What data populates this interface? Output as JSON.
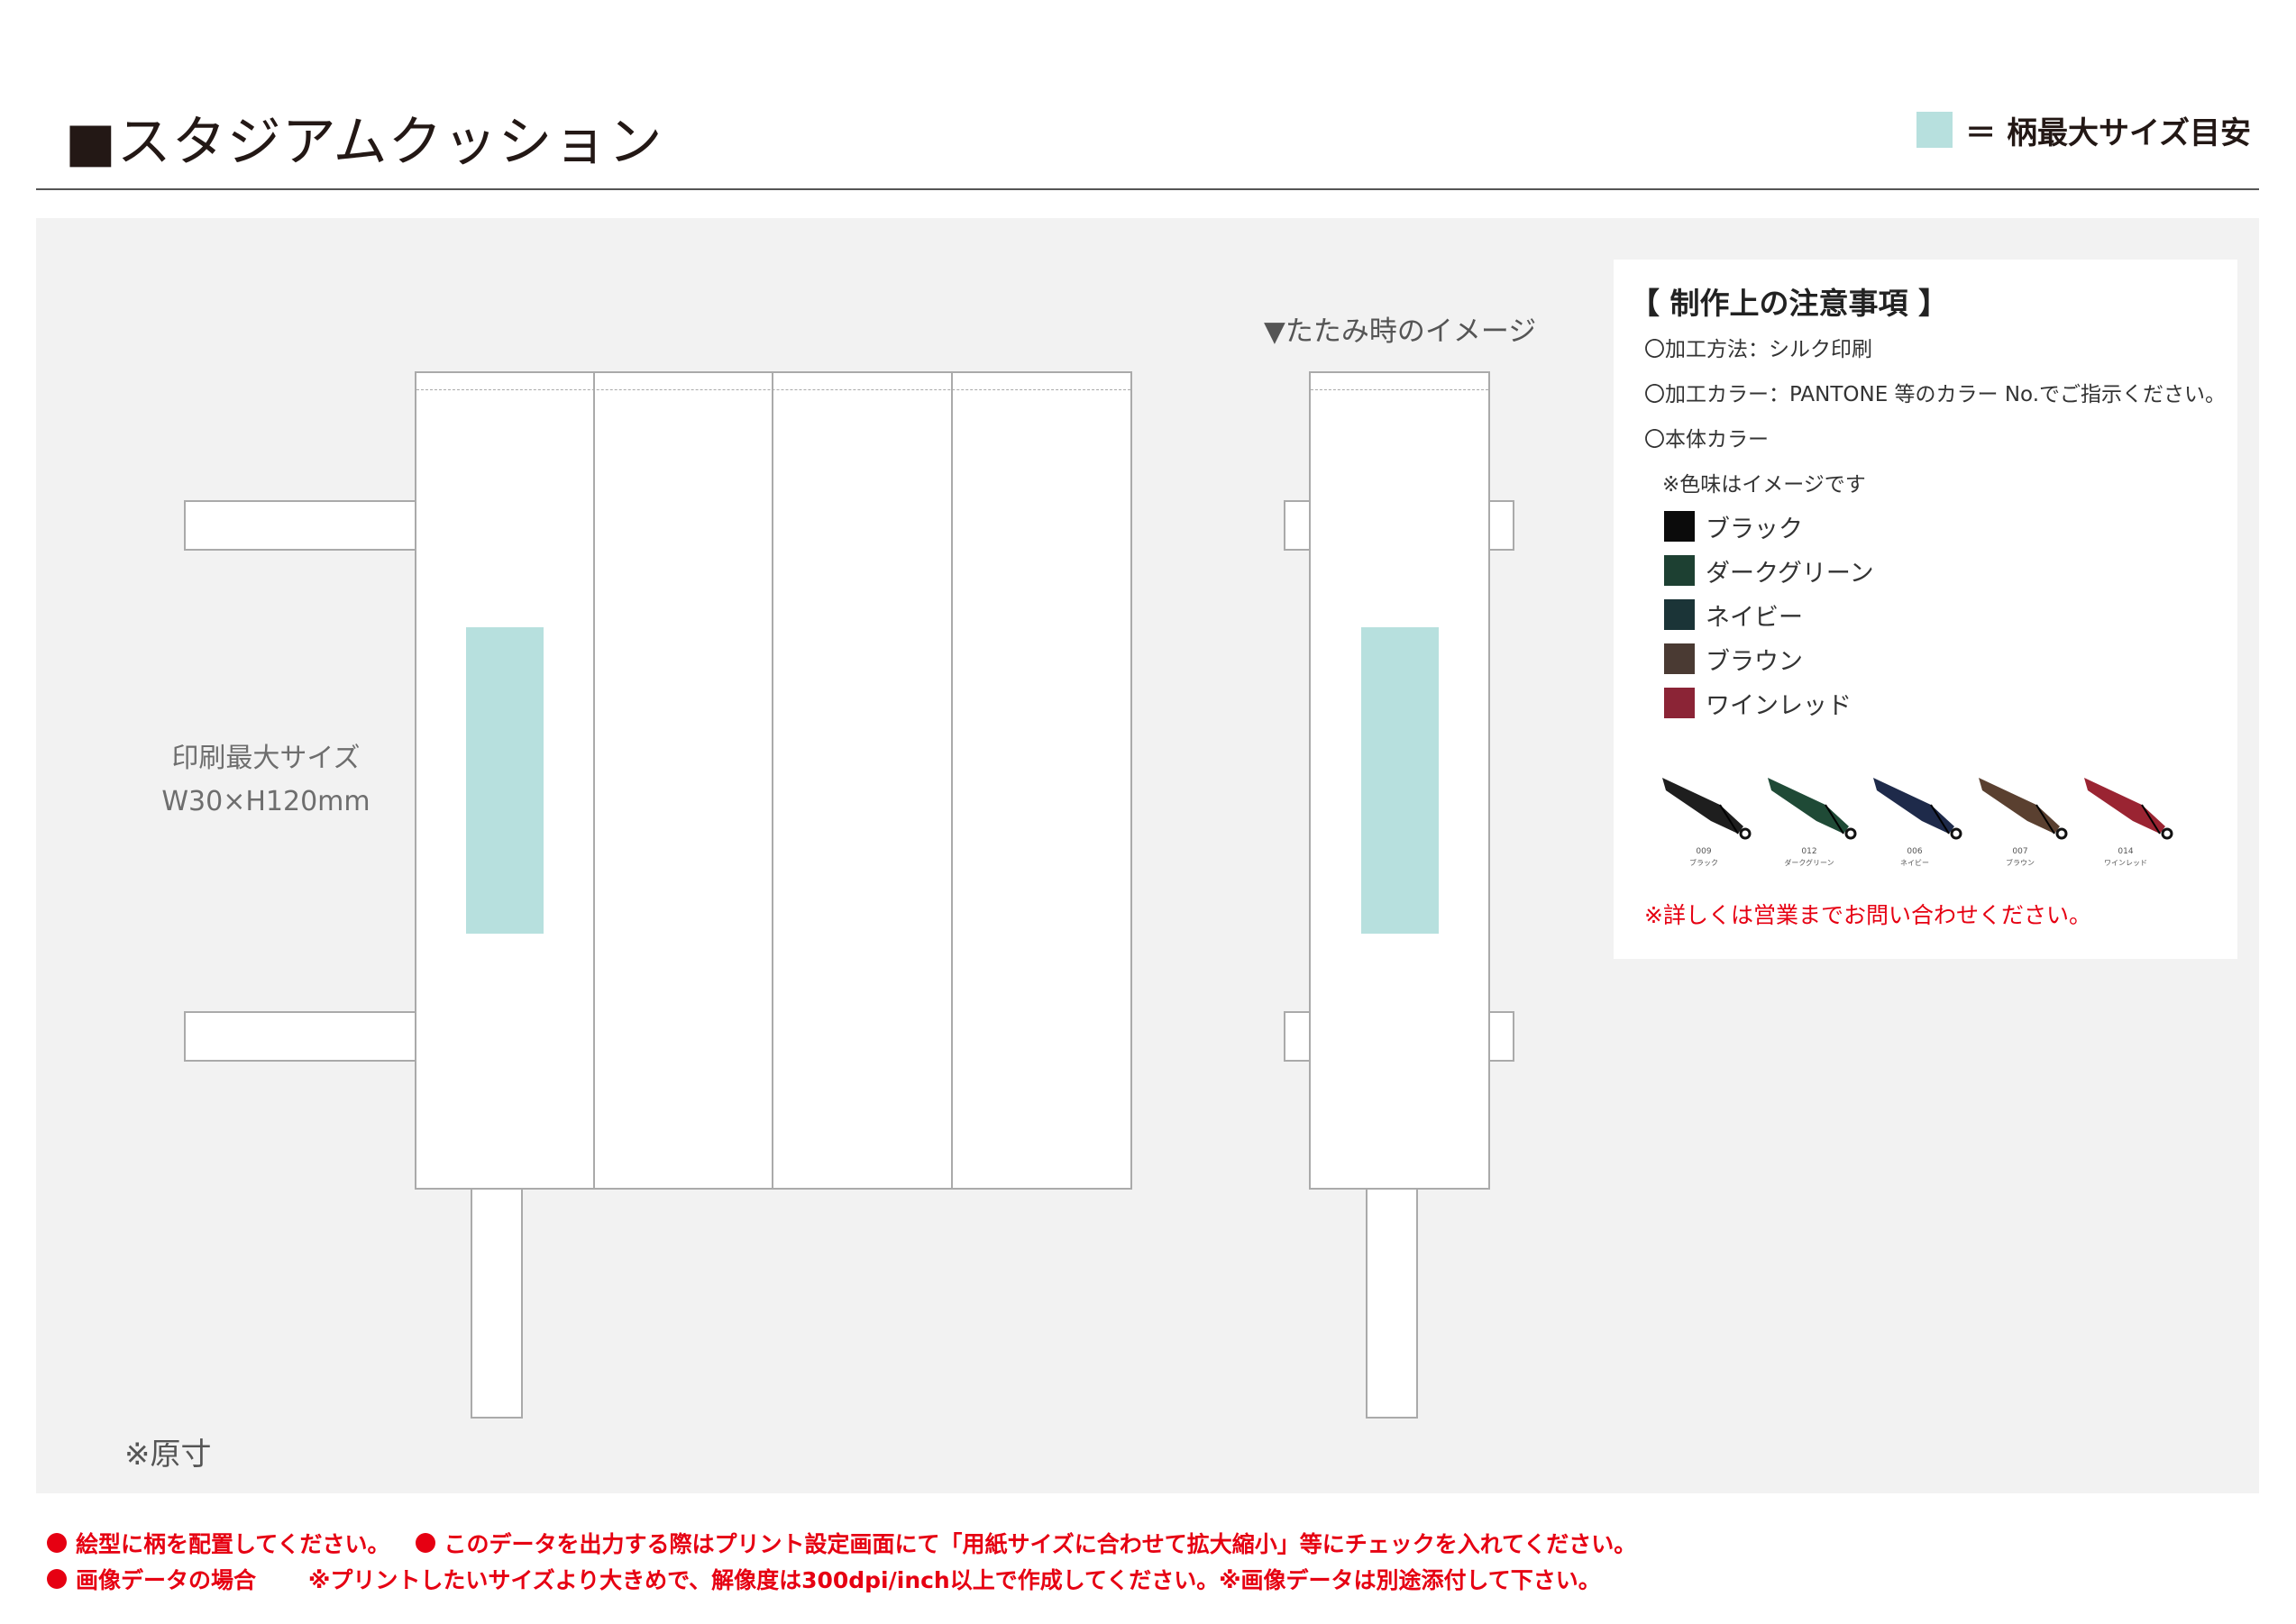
{
  "header": {
    "title": "■スタジアムクッション",
    "legend_label": "＝ 柄最大サイズ目安"
  },
  "drawing": {
    "max_size_label_line1": "印刷最大サイズ",
    "max_size_label_line2": "W30×H120mm",
    "folded_caption": "▼たたみ時のイメージ",
    "actual_size_note": "※原寸"
  },
  "notes": {
    "title": "【 制作上の注意事項 】",
    "lines": [
      "〇加工方法：シルク印刷",
      "〇加工カラー：PANTONE 等のカラー No.でご指示ください。",
      "〇本体カラー"
    ],
    "color_note": "※色味はイメージです",
    "colors": [
      {
        "label": "ブラック",
        "hex": "#0b0b0b"
      },
      {
        "label": "ダークグリーン",
        "hex": "#1d4032"
      },
      {
        "label": "ネイビー",
        "hex": "#1b3437"
      },
      {
        "label": "ブラウン",
        "hex": "#4a3a33"
      },
      {
        "label": "ワインレッド",
        "hex": "#8b2436"
      }
    ],
    "umbrellas": [
      {
        "code": "009",
        "name": "ブラック",
        "hex": "#1e1e1e"
      },
      {
        "code": "012",
        "name": "ダークグリーン",
        "hex": "#1f4a36"
      },
      {
        "code": "006",
        "name": "ネイビー",
        "hex": "#1e2a4a"
      },
      {
        "code": "007",
        "name": "ブラウン",
        "hex": "#5a4030"
      },
      {
        "code": "014",
        "name": "ワインレッド",
        "hex": "#9a2432"
      }
    ],
    "contact_note": "※詳しくは営業までお問い合わせください。"
  },
  "footer": {
    "line1_a": "絵型に柄を配置してください。",
    "line1_b": "このデータを出力する際はプリント設定画面にて「用紙サイズに合わせて拡大縮小」等にチェックを入れてください。",
    "line2_a": "画像データの場合",
    "line2_b": "※プリントしたいサイズより大きめで、解像度は300dpi/inch以上で作成してください。※画像データは別途添付して下さい。"
  },
  "colors": {
    "print_area": "#b7e0de",
    "panel": "#f2f2f2",
    "warning_red": "#e60012"
  }
}
